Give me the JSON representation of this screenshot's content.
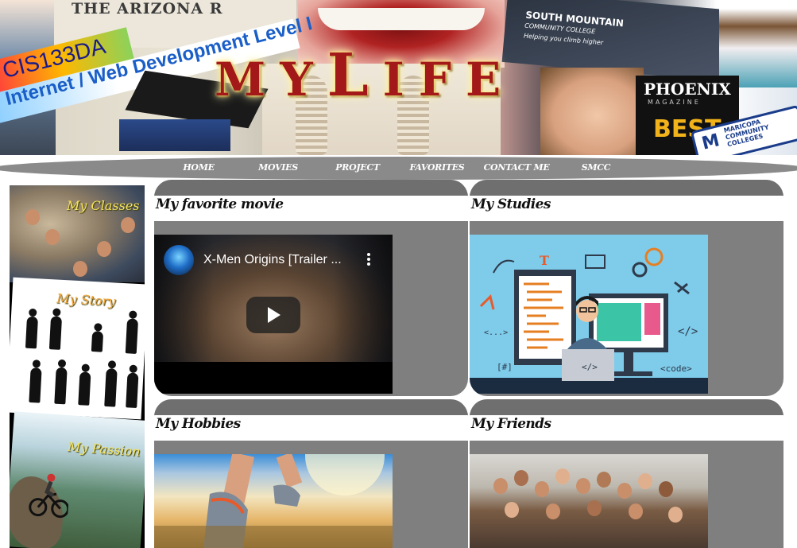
{
  "banner": {
    "title_letters": [
      "M",
      "Y",
      "L",
      "I",
      "F",
      "E"
    ],
    "newspaper_title": "THE ARIZONA R",
    "course_code": "CIS133DA",
    "course_name": "Internet / Web Development Level I",
    "college_name": "SOUTH MOUNTAIN",
    "college_sub": "COMMUNITY COLLEGE",
    "college_tagline": "Helping you climb higher",
    "magazine_title": "PHOENIX",
    "magazine_sub": "MAGAZINE",
    "magazine_best": "BEST",
    "district_name": "MARICOPA COMMUNITY COLLEGES",
    "district_logo": "M"
  },
  "nav": {
    "items": [
      {
        "label": "HOME"
      },
      {
        "label": "MOVIES"
      },
      {
        "label": "PROJECT"
      },
      {
        "label": "FAVORITES"
      },
      {
        "label": "CONTACT ME"
      },
      {
        "label": "SMCC"
      }
    ]
  },
  "sidebar": {
    "classes_label": "My Classes",
    "story_label": "My Story",
    "passion_label": "My Passion"
  },
  "cards": {
    "movie": {
      "title": "My favorite movie",
      "video_title": "X-Men Origins [Trailer ..."
    },
    "studies": {
      "title": "My Studies",
      "code_tags": [
        "</>",
        "<code>",
        "<...>",
        "[#]",
        "</>"
      ]
    },
    "hobbies": {
      "title": "My Hobbies"
    },
    "friends": {
      "title": "My Friends"
    }
  },
  "icons": {
    "play": "play-icon",
    "menu": "more-vert-icon"
  },
  "colors": {
    "nav_bg": "#8a8a8a",
    "card_bg": "#7f7f7f",
    "title_red": "#a31818",
    "sidebar_label": "#f6e45c"
  }
}
